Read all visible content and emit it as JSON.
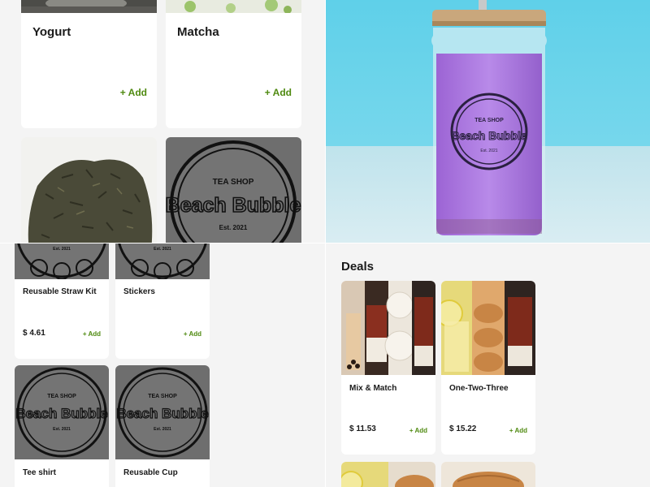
{
  "top_menu": {
    "items": [
      {
        "name": "Yogurt",
        "add": "+ Add"
      },
      {
        "name": "Matcha",
        "add": "+ Add"
      }
    ]
  },
  "hero": {
    "logo_top": "TEA SHOP",
    "logo_main": "Beach Bubble",
    "logo_sub": "Est. 2021"
  },
  "merch": {
    "items": [
      {
        "name": "Reusable Straw Kit",
        "price": "$ 4.61",
        "add": "+ Add"
      },
      {
        "name": "Stickers",
        "add": "+ Add"
      },
      {
        "name": "Tee shirt"
      },
      {
        "name": "Reusable Cup"
      }
    ]
  },
  "deals": {
    "title": "Deals",
    "items": [
      {
        "name": "Mix & Match",
        "price": "$ 11.53",
        "add": "+ Add"
      },
      {
        "name": "One-Two-Three",
        "price": "$ 15.22",
        "add": "+ Add"
      }
    ]
  },
  "logo_tile": {
    "top": "TEA SHOP",
    "main": "Beach Bubble",
    "sub": "Est. 2021"
  },
  "colors": {
    "accent": "#4f8a10",
    "sky": "#6fd0e8",
    "drink": "#b07be0",
    "logo_gray": "#6e6e6e"
  }
}
